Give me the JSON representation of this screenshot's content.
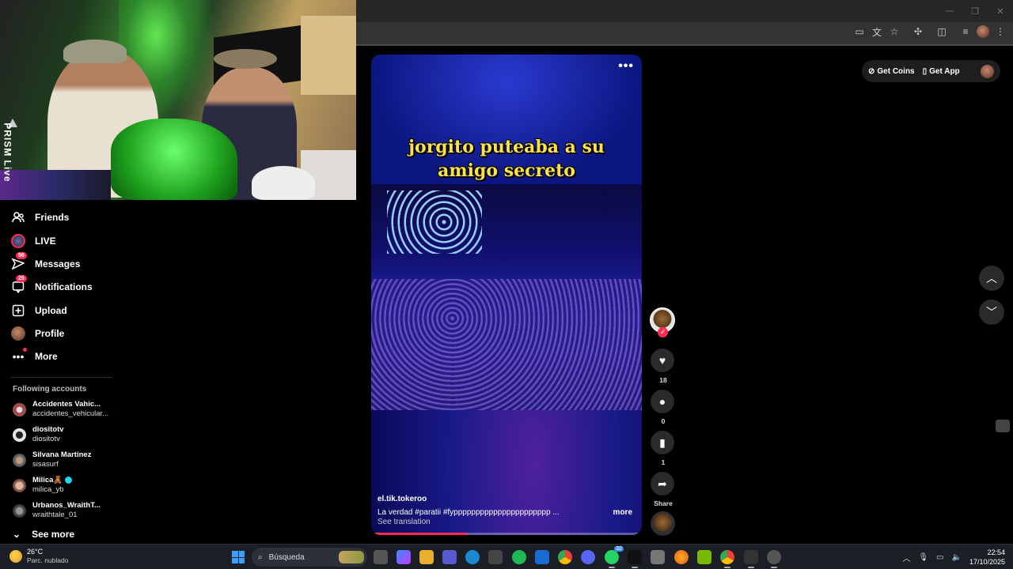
{
  "browser": {
    "window_controls": [
      "—",
      "❐",
      "✕"
    ],
    "toolbar_icons": [
      "cast-icon",
      "translate-icon",
      "star-icon",
      "extensions-icon",
      "sidepanel-icon",
      "media-icon",
      "profile-avatar",
      "menu-icon"
    ]
  },
  "webcam": {
    "overlay_label": "PRISM Live"
  },
  "sidebar": {
    "items": [
      {
        "label": "Friends",
        "icon": "friends-icon"
      },
      {
        "label": "LIVE",
        "icon": "live-icon"
      },
      {
        "label": "Messages",
        "icon": "messages-icon",
        "badge": "56"
      },
      {
        "label": "Notifications",
        "icon": "notifications-icon",
        "badge": "25"
      },
      {
        "label": "Upload",
        "icon": "upload-icon"
      },
      {
        "label": "Profile",
        "icon": "profile-avatar"
      },
      {
        "label": "More",
        "icon": "more-icon"
      }
    ],
    "following_title": "Following accounts",
    "following": [
      {
        "name": "Accidentes Vahic...",
        "handle": "accidentes_vehicular...",
        "color": "#b03a3a"
      },
      {
        "name": "diositotv",
        "handle": "diositotv",
        "color": "#dddddd"
      },
      {
        "name": "Silvana Martinez",
        "handle": "sisasurf",
        "color": "#8a8a8a"
      },
      {
        "name": "Milica🧸",
        "handle": "milica_yb",
        "color": "#c09080",
        "verified": true
      },
      {
        "name": "Urbanos_WraithT...",
        "handle": "wraithtale_01",
        "color": "#5a5a5a"
      }
    ],
    "see_more": "See more"
  },
  "video": {
    "overlay_title_line1": "jorgito puteaba a su",
    "overlay_title_line2": "amigo secreto",
    "author": "el.tik.tokeroo",
    "description": "La verdad #paratii  #fypppppppppppppppppppppp  ...",
    "more": "more",
    "see_translation": "See translation",
    "progress": 0.35
  },
  "actions": {
    "likes": "18",
    "comments": "0",
    "saves": "1",
    "share_label": "Share"
  },
  "top_right": {
    "get_coins": "Get Coins",
    "get_app": "Get App"
  },
  "taskbar": {
    "weather_temp": "26°C",
    "weather_desc": "Parc. nublado",
    "search_placeholder": "Búsqueda",
    "teams_badge": "32",
    "time": "22:54",
    "date": "17/10/2025"
  },
  "colors": {
    "accent": "#fe2c55",
    "title_yellow": "#ffe24a",
    "taskbar_bg": "#1b1e24"
  }
}
